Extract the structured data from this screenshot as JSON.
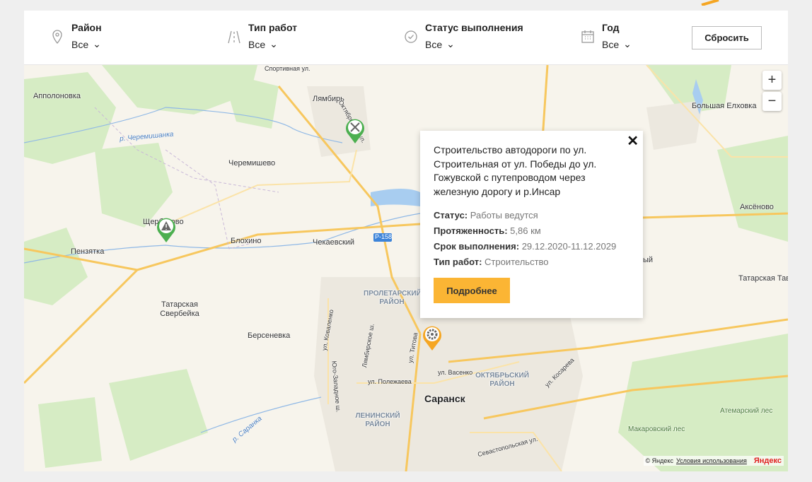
{
  "filters": [
    {
      "label": "Район",
      "value": "Все",
      "icon": "map-pin-icon"
    },
    {
      "label": "Тип работ",
      "value": "Все",
      "icon": "road-icon"
    },
    {
      "label": "Статус выполнения",
      "value": "Все",
      "icon": "check-circle-icon"
    },
    {
      "label": "Год",
      "value": "Все",
      "icon": "calendar-icon"
    }
  ],
  "reset_label": "Сбросить",
  "map": {
    "labels": {
      "appolonovka": "Апполоновка",
      "lyambir": "Лямбирь",
      "sport": "Спортивная ул.",
      "oktyabr": "Октябрьская ул.",
      "cheremishanka": "р. Черемишанка",
      "cheremishevo": "Черемишево",
      "shcherbakovo": "Щербаково",
      "penzyatka": "Пензятка",
      "blokhino": "Блохино",
      "chekaevsky": "Чекаевский",
      "r158": "Р-158",
      "tatsver": "Татарская Свербейка",
      "bersenevka": "Берсеневка",
      "proletarsky": "ПРОЛЕТАРСКИЙ РАЙОН",
      "oktyabrsky": "ОКТЯБРЬСКИЙ РАЙОН",
      "leninsky": "ЛЕНИНСКИЙ РАЙОН",
      "saransk": "Саранск",
      "bolelkhovka": "Большая Елховка",
      "aksenovo": "Аксёново",
      "tattavla": "Татарская Тавла",
      "atemar": "Атемарский лес",
      "makarov": "Макаровский лес",
      "polezhaeva": "ул. Полежаева",
      "vasenko": "ул. Васенко",
      "kosareva": "ул. Косарева",
      "titova": "ул. Титова",
      "sevast": "Севастопольская ул.",
      "lyambir_sh": "Лямбирское ш.",
      "yugozap": "Юго-Западное ш.",
      "kovalenko": "ул. Коваленко",
      "saranka": "р. Саранка",
      "partial": "ый"
    },
    "zoom_in": "+",
    "zoom_out": "−",
    "copyright": "© Яндекс",
    "terms": "Условия использования",
    "logo": "Яндекс"
  },
  "markers": [
    {
      "name": "repair",
      "icon": "wrench-screwdriver-icon",
      "color": "#4caf50"
    },
    {
      "name": "warning",
      "icon": "warning-icon",
      "color": "#4caf50"
    },
    {
      "name": "construction",
      "icon": "gear-icon",
      "color": "#f5a623"
    }
  ],
  "popup": {
    "title": "Строительство автодороги по ул. Строительная от ул. Победы до ул. Гожувской с путепроводом через железную дорогу и р.Инсар",
    "status_label": "Статус:",
    "status": "Работы ведутся",
    "length_label": "Протяженность:",
    "length": "5,86 км",
    "term_label": "Срок выполнения:",
    "term": "29.12.2020-11.12.2029",
    "type_label": "Тип работ:",
    "type": "Строительство",
    "more": "Подробнее"
  },
  "colors": {
    "accent": "#fbb534",
    "marker_green": "#4caf50",
    "marker_orange": "#f5a623"
  }
}
